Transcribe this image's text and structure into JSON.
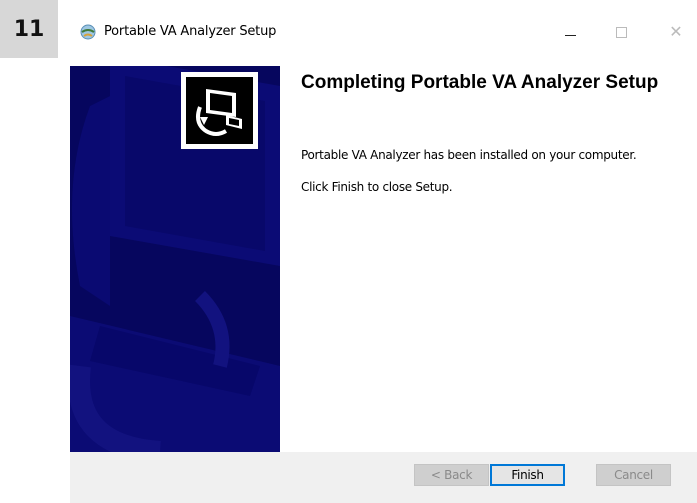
{
  "step": "11",
  "window": {
    "title": "Portable VA Analyzer Setup",
    "app_icon": "setup-globe-icon",
    "controls": {
      "minimize": "minimize-icon",
      "maximize": "maximize-icon",
      "close": "close-icon",
      "close_glyph": "✕"
    }
  },
  "banner": {
    "bg_color": "#06065e",
    "logo_icon": "installer-computer-icon"
  },
  "content": {
    "heading": "Completing Portable VA Analyzer Setup",
    "line1": "Portable VA Analyzer has been installed on your computer.",
    "line2": "Click Finish to close Setup."
  },
  "buttons": {
    "back": "< Back",
    "finish": "Finish",
    "cancel": "Cancel"
  },
  "colors": {
    "accent": "#0078d7",
    "footer": "#f0f0f0"
  }
}
